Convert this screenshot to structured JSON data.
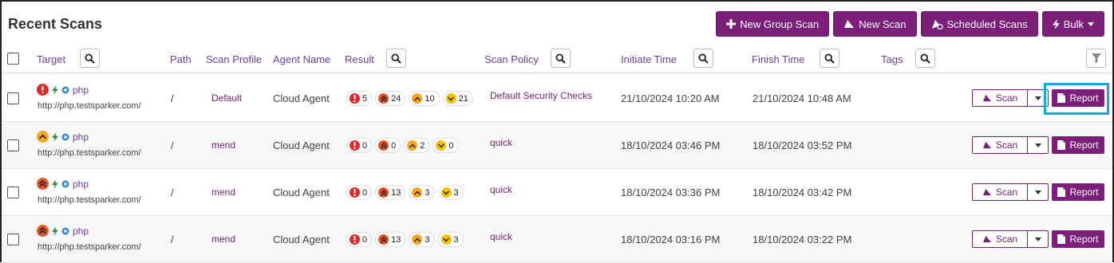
{
  "title": "Recent Scans",
  "toolbar": {
    "new_group_scan": "New Group Scan",
    "new_scan": "New Scan",
    "scheduled_scans": "Scheduled Scans",
    "bulk": "Bulk"
  },
  "columns": {
    "target": "Target",
    "path": "Path",
    "scan_profile": "Scan Profile",
    "agent_name": "Agent Name",
    "result": "Result",
    "scan_policy": "Scan Policy",
    "initiate_time": "Initiate Time",
    "finish_time": "Finish Time",
    "tags": "Tags"
  },
  "rows": [
    {
      "severity_icon": "critical-icon",
      "name": "php",
      "url": "http://php.testsparker.com/",
      "path": "/",
      "profile": "Default",
      "agent": "Cloud Agent",
      "results": {
        "critical": "5",
        "high": "24",
        "medium": "10",
        "low": "21"
      },
      "policy": "Default Security Checks",
      "initiate": "21/10/2024 10:20 AM",
      "finish": "21/10/2024 10:48 AM"
    },
    {
      "severity_icon": "medium-icon",
      "name": "php",
      "url": "http://php.testsparker.com/",
      "path": "/",
      "profile": "mend",
      "agent": "Cloud Agent",
      "results": {
        "critical": "0",
        "high": "0",
        "medium": "2",
        "low": "0"
      },
      "policy": "quick",
      "initiate": "18/10/2024 03:46 PM",
      "finish": "18/10/2024 03:52 PM"
    },
    {
      "severity_icon": "high-icon",
      "name": "php",
      "url": "http://php.testsparker.com/",
      "path": "/",
      "profile": "mend",
      "agent": "Cloud Agent",
      "results": {
        "critical": "0",
        "high": "13",
        "medium": "3",
        "low": "3"
      },
      "policy": "quick",
      "initiate": "18/10/2024 03:36 PM",
      "finish": "18/10/2024 03:42 PM"
    },
    {
      "severity_icon": "high-icon",
      "name": "php",
      "url": "http://php.testsparker.com/",
      "path": "/",
      "profile": "mend",
      "agent": "Cloud Agent",
      "results": {
        "critical": "0",
        "high": "13",
        "medium": "3",
        "low": "3"
      },
      "policy": "quick",
      "initiate": "18/10/2024 03:16 PM",
      "finish": "18/10/2024 03:22 PM"
    }
  ],
  "row_actions": {
    "scan": "Scan",
    "report": "Report"
  },
  "colors": {
    "brand": "#7b1f7a",
    "highlight": "#12a7e6",
    "critical": "#e02b2b",
    "high": "#e8562a",
    "medium": "#f5a623",
    "low": "#f3c300"
  }
}
